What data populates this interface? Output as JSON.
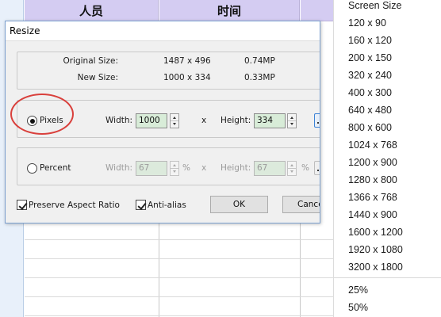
{
  "sheet": {
    "headers": [
      "人员",
      "时间"
    ]
  },
  "dialog": {
    "title": "Resize",
    "original_size_label": "Original Size:",
    "original_size_dims": "1487 x 496",
    "original_size_mp": "0.74MP",
    "new_size_label": "New Size:",
    "new_size_dims": "1000 x 334",
    "new_size_mp": "0.33MP",
    "pixels_label": "Pixels",
    "pixels_selected": true,
    "width_label": "Width:",
    "width_value": "1000",
    "x_sep": "x",
    "height_label": "Height:",
    "height_value": "334",
    "percent_label": "Percent",
    "percent_selected": false,
    "percent_width_value": "67",
    "percent_height_value": "67",
    "percent_unit": "%",
    "preserve_aspect_label": "Preserve Aspect Ratio",
    "preserve_aspect_checked": true,
    "antialias_label": "Anti-alias",
    "antialias_checked": true,
    "ok_label": "OK",
    "cancel_label": "Cance"
  },
  "menu": {
    "items": [
      "Screen Size",
      "120 x 90",
      "160 x 120",
      "200 x 150",
      "320 x 240",
      "400 x 300",
      "640 x 480",
      "800 x 600",
      "1024 x 768",
      "1200 x 900",
      "1280 x 800",
      "1366 x 768",
      "1440 x 900",
      "1600 x 1200",
      "1920 x 1080",
      "3200 x 1800"
    ],
    "percent_items": [
      "25%",
      "50%"
    ]
  },
  "colors": {
    "highlight": "#d9403c",
    "header_bg": "#d4ccf2",
    "field_bg": "#d8ecd8"
  }
}
